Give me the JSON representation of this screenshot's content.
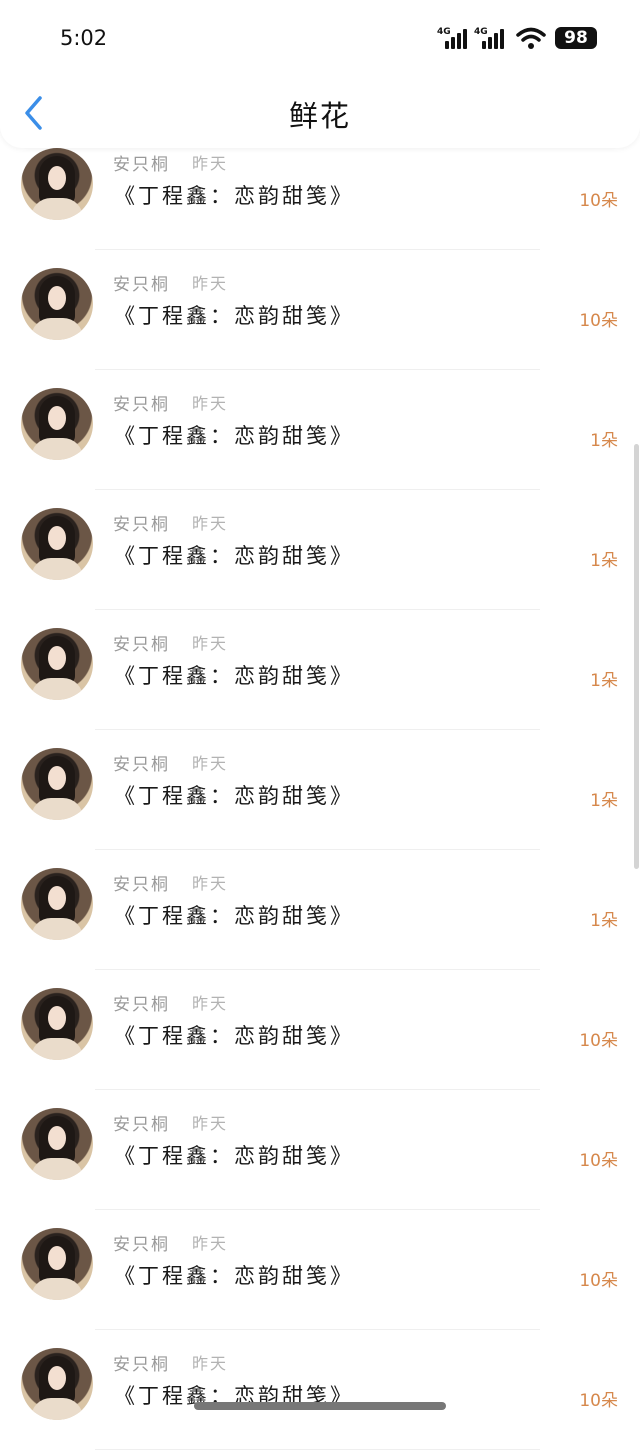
{
  "status_bar": {
    "time": "5:02",
    "network_1": "4G",
    "network_2": "4G",
    "battery": "98"
  },
  "header": {
    "title": "鲜花",
    "back_icon": "chevron-left-icon"
  },
  "colors": {
    "accent_back": "#3b8ee8",
    "count_orange": "#d6884c"
  },
  "list": {
    "items": [
      {
        "name": "安只桐",
        "time": "昨天",
        "book": "《丁程鑫：恋韵甜笺》",
        "count": "10朵"
      },
      {
        "name": "安只桐",
        "time": "昨天",
        "book": "《丁程鑫：恋韵甜笺》",
        "count": "10朵"
      },
      {
        "name": "安只桐",
        "time": "昨天",
        "book": "《丁程鑫：恋韵甜笺》",
        "count": "1朵"
      },
      {
        "name": "安只桐",
        "time": "昨天",
        "book": "《丁程鑫：恋韵甜笺》",
        "count": "1朵"
      },
      {
        "name": "安只桐",
        "time": "昨天",
        "book": "《丁程鑫：恋韵甜笺》",
        "count": "1朵"
      },
      {
        "name": "安只桐",
        "time": "昨天",
        "book": "《丁程鑫：恋韵甜笺》",
        "count": "1朵"
      },
      {
        "name": "安只桐",
        "time": "昨天",
        "book": "《丁程鑫：恋韵甜笺》",
        "count": "1朵"
      },
      {
        "name": "安只桐",
        "time": "昨天",
        "book": "《丁程鑫：恋韵甜笺》",
        "count": "10朵"
      },
      {
        "name": "安只桐",
        "time": "昨天",
        "book": "《丁程鑫：恋韵甜笺》",
        "count": "10朵"
      },
      {
        "name": "安只桐",
        "time": "昨天",
        "book": "《丁程鑫：恋韵甜笺》",
        "count": "10朵"
      },
      {
        "name": "安只桐",
        "time": "昨天",
        "book": "《丁程鑫：恋韵甜笺》",
        "count": "10朵"
      }
    ]
  }
}
